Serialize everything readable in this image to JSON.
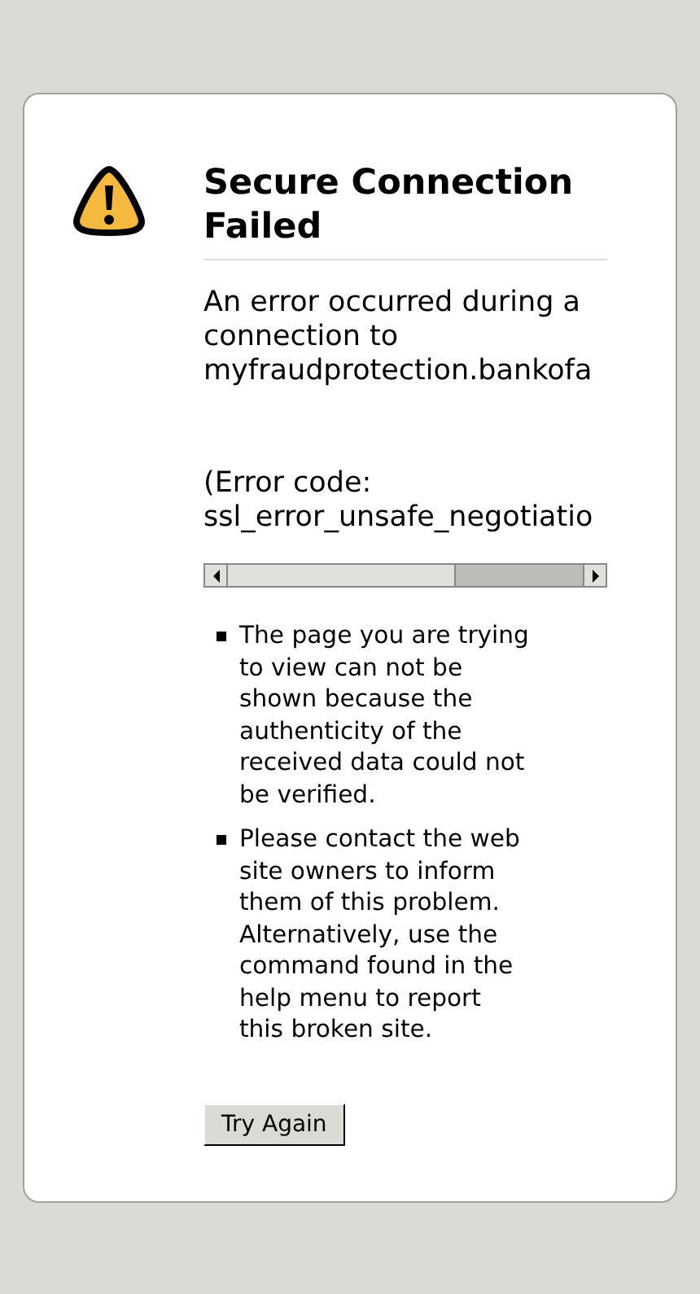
{
  "title": "Secure Connection Failed",
  "description": "An error occurred during a connection to myfraudprotection.bankofa",
  "error_code": "(Error code: ssl_error_unsafe_negotiatio",
  "bullets": [
    "The page you are trying to view can not be shown because the authenticity of the received data could not be verified.",
    "Please contact the web site owners to inform them of this problem. Alternatively, use the command found in the help menu to report this broken site."
  ],
  "button": "Try Again"
}
